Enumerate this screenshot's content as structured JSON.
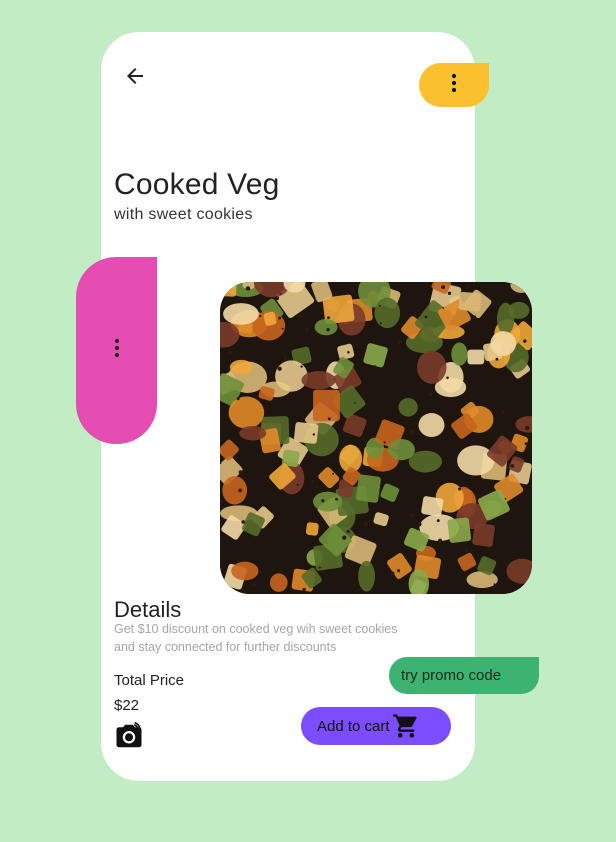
{
  "product": {
    "title": "Cooked Veg",
    "subtitle": "with sweet cookies"
  },
  "details": {
    "heading": "Details",
    "description": "Get $10 discount on cooked veg wih sweet cookies and stay connected for further discounts"
  },
  "pricing": {
    "total_label": "Total Price",
    "price": "$22"
  },
  "actions": {
    "promo_label": "try promo code",
    "cart_label": "Add to cart"
  },
  "icons": {
    "back": "arrow-back-icon",
    "menu": "more-vert-icon",
    "camera": "camera-icon",
    "cart": "shopping-cart-icon"
  },
  "colors": {
    "background": "#c2ecc4",
    "card": "#ffffff",
    "yellow_menu": "#fbc02d",
    "pink_tab": "#e64db3",
    "promo": "#3cb371",
    "cart": "#7c4dff"
  }
}
